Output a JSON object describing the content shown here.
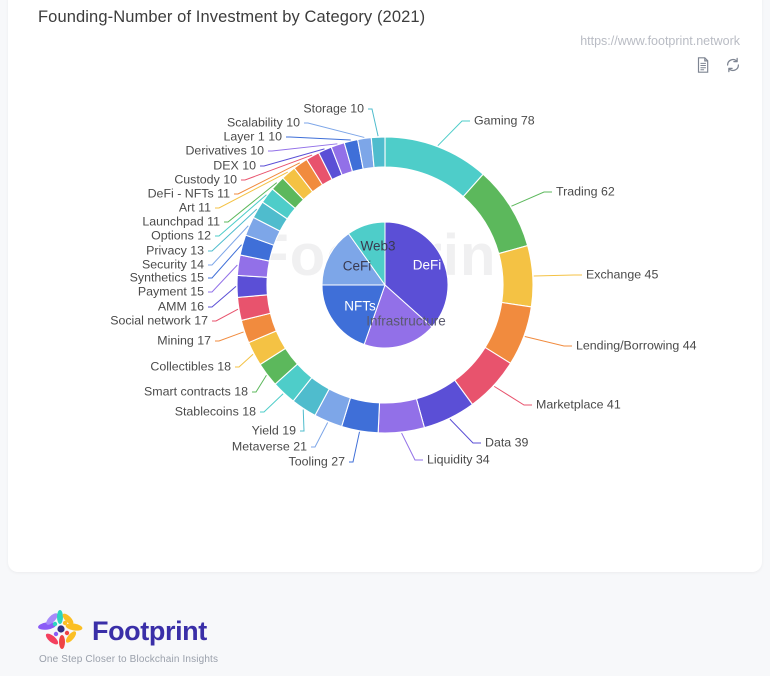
{
  "header": {
    "title": "Founding-Number of Investment by Category  (2021)",
    "source_url": "https://www.footprint.network",
    "icons": [
      {
        "name": "document-icon",
        "label": "document"
      },
      {
        "name": "refresh-icon",
        "label": "refresh"
      }
    ]
  },
  "watermark": "Footprint",
  "footer": {
    "brand": "Footprint",
    "tagline": "One Step Closer to Blockchain Insights",
    "logo_name": "footprint-flower-logo"
  },
  "chart_data": {
    "type": "pie",
    "title": "Founding-Number of Investment by Category  (2021)",
    "subtype": "nested-donut",
    "legend": "none",
    "labels_show_value": true,
    "outer_ring": {
      "name": "Category",
      "categories": [
        "Gaming",
        "Trading",
        "Exchange",
        "Lending/Borrowing",
        "Marketplace",
        "Data",
        "Liquidity",
        "Tooling",
        "Metaverse",
        "Yield",
        "Stablecoins",
        "Smart contracts",
        "Collectibles",
        "Mining",
        "Social network",
        "AMM",
        "Payment",
        "Synthetics",
        "Security",
        "Privacy",
        "Options",
        "Launchpad",
        "Art",
        "DeFi - NFTs",
        "Custody",
        "DEX",
        "Derivatives",
        "Layer 1",
        "Scalability",
        "Storage"
      ],
      "values": [
        78,
        62,
        45,
        44,
        41,
        39,
        34,
        27,
        21,
        19,
        18,
        18,
        18,
        17,
        17,
        16,
        15,
        15,
        14,
        13,
        12,
        11,
        11,
        11,
        10,
        10,
        10,
        10,
        10,
        10
      ],
      "colors": [
        "#4ecdc9",
        "#5cb85c",
        "#f4c244",
        "#f18b3e",
        "#e8536d",
        "#5b4fd6",
        "#9270e8",
        "#3f6fd8",
        "#7da6e8",
        "#4fbccd",
        "#4ecdc9",
        "#5cb85c",
        "#f4c244",
        "#f18b3e",
        "#e8536d",
        "#5b4fd6",
        "#9270e8",
        "#3f6fd8",
        "#7da6e8",
        "#4fbccd",
        "#4ecdc9",
        "#5cb85c",
        "#f4c244",
        "#f18b3e",
        "#e8536d",
        "#5b4fd6",
        "#9270e8",
        "#3f6fd8",
        "#7da6e8",
        "#4fbccd"
      ]
    },
    "inner_pie": {
      "name": "Sector",
      "categories": [
        "DeFi",
        "Infrastructure",
        "NFTs",
        "CeFi",
        "Web3"
      ],
      "values": [
        205,
        105,
        110,
        85,
        55
      ],
      "colors": [
        "#5b4fd6",
        "#9270e8",
        "#3f6fd8",
        "#7da6e8",
        "#4ecdc9"
      ],
      "label_colors": [
        "#ffffff",
        "#5a5a6e",
        "#ffffff",
        "#3a3a50",
        "#3a3a50"
      ]
    }
  }
}
